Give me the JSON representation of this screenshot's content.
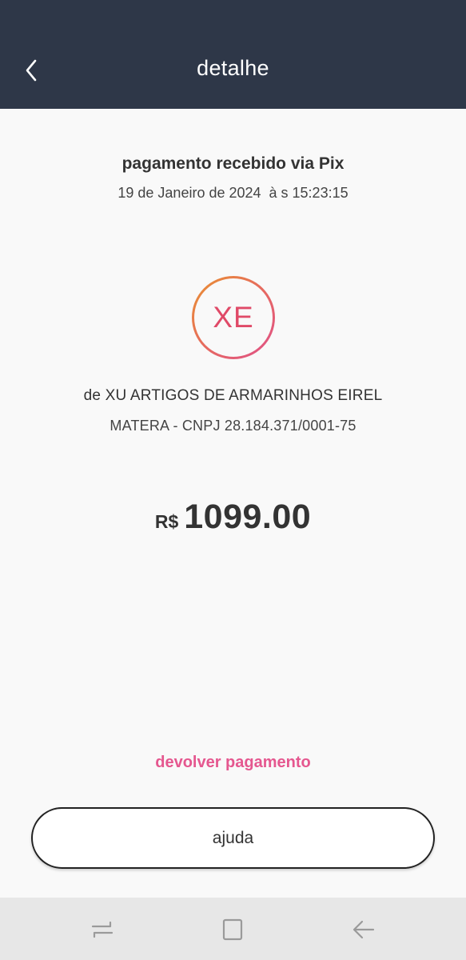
{
  "header": {
    "title": "detalhe",
    "back_icon": "chevron-left-icon"
  },
  "transaction": {
    "title": "pagamento recebido via Pix",
    "date": "19 de Janeiro de 2024  à s 15:23:15"
  },
  "payer": {
    "initials": "XE",
    "name": "de XU ARTIGOS DE ARMARINHOS EIREL",
    "bank": "MATERA - CNPJ 28.184.371/0001-75"
  },
  "amount": {
    "currency": "R$",
    "value": "1099.00"
  },
  "actions": {
    "refund_label": "devolver pagamento",
    "help_label": "ajuda"
  },
  "navbar": {
    "icons": [
      "recent-apps-icon",
      "home-icon",
      "back-arrow-icon"
    ]
  },
  "colors": {
    "header_bg": "#2e3748",
    "accent_pink": "#e5578f",
    "avatar_gradient_start": "#e9922f",
    "avatar_gradient_end": "#e0508a",
    "navbar_bg": "#e7e7e7"
  }
}
